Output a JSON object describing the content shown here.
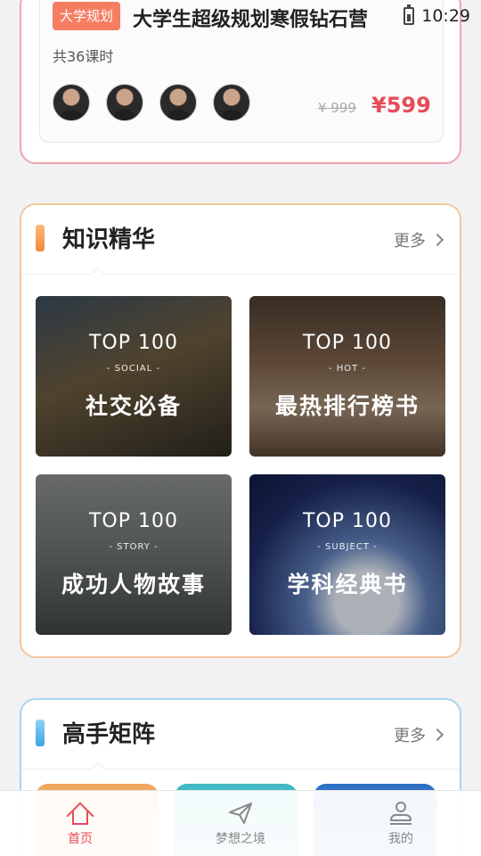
{
  "status_bar": {
    "time": "10:29"
  },
  "course": {
    "tag": "大学规划",
    "title": "大学生超级规划寒假钻石营",
    "lessons": "共36课时",
    "old_price": "¥ 999",
    "price": "¥599",
    "instructor_count": 4
  },
  "knowledge": {
    "title": "知识精华",
    "more": "更多",
    "tiles": [
      {
        "top": "TOP 100",
        "sub": "- SOCIAL -",
        "label": "社交必备"
      },
      {
        "top": "TOP 100",
        "sub": "- HOT -",
        "label": "最热排行榜书"
      },
      {
        "top": "TOP 100",
        "sub": "- STORY -",
        "label": "成功人物故事"
      },
      {
        "top": "TOP 100",
        "sub": "- SUBJECT -",
        "label": "学科经典书"
      }
    ]
  },
  "experts": {
    "title": "高手矩阵",
    "more": "更多"
  },
  "nav": [
    {
      "label": "首页",
      "icon": "home-icon",
      "active": true
    },
    {
      "label": "梦想之境",
      "icon": "paper-plane-icon",
      "active": false
    },
    {
      "label": "我的",
      "icon": "user-icon",
      "active": false
    }
  ],
  "colors": {
    "accent": "#e84b5a",
    "knowledge_border": "#f6c79a",
    "experts_border": "#a7d6f0",
    "course_border": "#f2a4ae"
  }
}
